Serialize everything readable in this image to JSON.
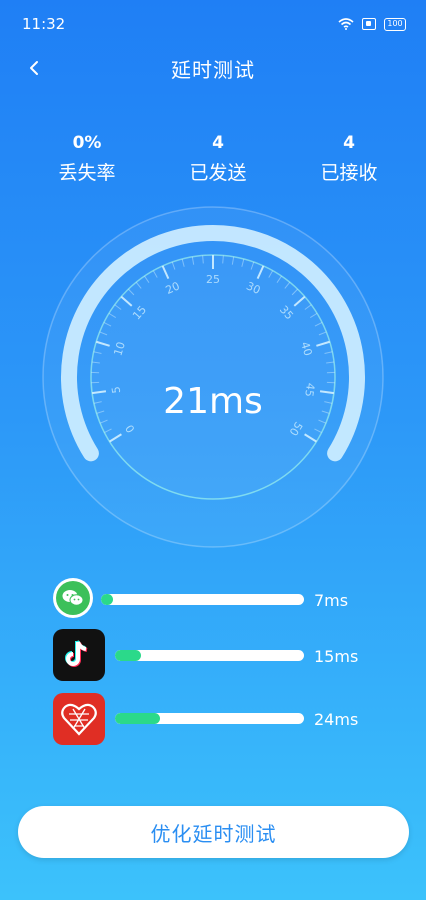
{
  "status_bar": {
    "time": "11:32",
    "battery": "100"
  },
  "nav": {
    "title": "延时测试"
  },
  "stats": [
    {
      "value": "0%",
      "label": "丢失率"
    },
    {
      "value": "4",
      "label": "已发送"
    },
    {
      "value": "4",
      "label": "已接收"
    }
  ],
  "gauge": {
    "value_text": "21ms",
    "value": 21,
    "scale_min": 0,
    "scale_max": 50,
    "tick_labels": [
      "0",
      "5",
      "10",
      "15",
      "20",
      "25",
      "30",
      "35",
      "40",
      "45",
      "50"
    ]
  },
  "apps": [
    {
      "icon": "wechat-icon",
      "latency": "7ms",
      "fill_fraction": 0.06
    },
    {
      "icon": "tiktok-icon",
      "latency": "15ms",
      "fill_fraction": 0.14
    },
    {
      "icon": "pinduoduo-icon",
      "latency": "24ms",
      "fill_fraction": 0.24
    }
  ],
  "actions": {
    "optimize_label": "优化延时测试"
  },
  "colors": {
    "accent": "#2a8ef2",
    "bar_fill": "#2bd98a",
    "wechat": "#3cc05a",
    "pinduoduo": "#e02e24",
    "tiktok": "#111111"
  }
}
